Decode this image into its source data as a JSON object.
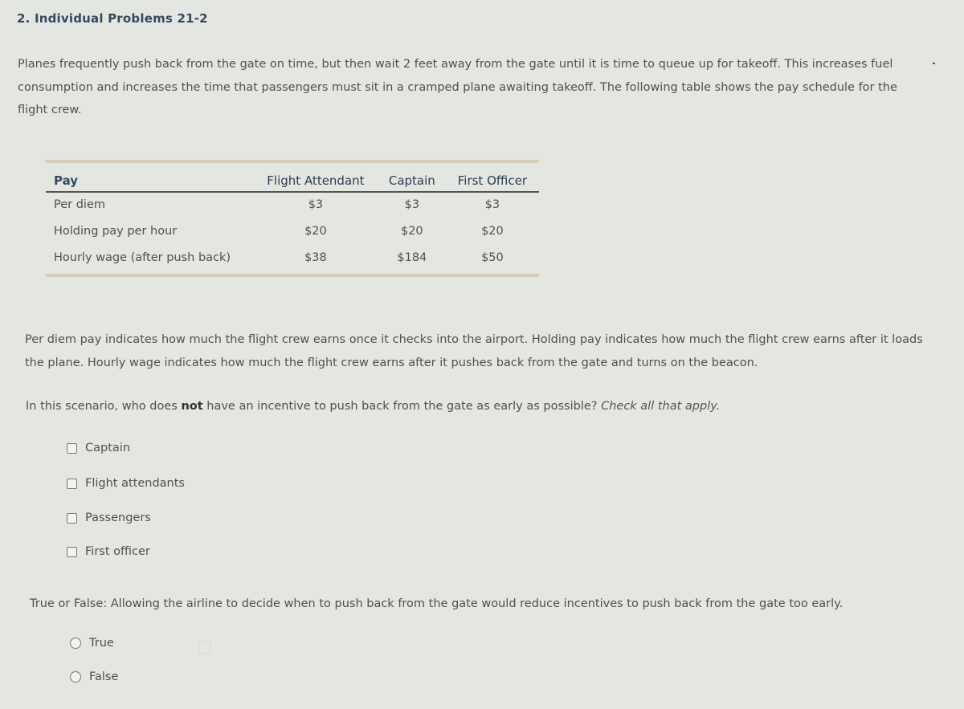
{
  "title": "2. Individual Problems 21-2",
  "intro": "Planes frequently push back from the gate on time, but then wait 2 feet away from the gate until it is time to queue up for takeoff. This increases fuel consumption and increases the time that passengers must sit in a cramped plane awaiting takeoff. The following table shows the pay schedule for the flight crew.",
  "table": {
    "headers": [
      "Pay",
      "Flight Attendant",
      "Captain",
      "First Officer"
    ],
    "rows": [
      [
        "Per diem",
        "$3",
        "$3",
        "$3"
      ],
      [
        "Holding pay per hour",
        "$20",
        "$20",
        "$20"
      ],
      [
        "Hourly wage (after push back)",
        "$38",
        "$184",
        "$50"
      ]
    ]
  },
  "explanation": "Per diem pay indicates how much the flight crew earns once it checks into the airport. Holding pay indicates how much the flight crew earns after it loads the plane. Hourly wage indicates how much the flight crew earns after it pushes back from the gate and turns on the beacon.",
  "question1": {
    "prefix": "In this scenario, who does ",
    "bold": "not",
    "middle": " have an incentive to push back from the gate as early as possible? ",
    "instruction": "Check all that apply.",
    "options": [
      {
        "label": "Captain",
        "checked": false
      },
      {
        "label": "Flight attendants",
        "checked": false
      },
      {
        "label": "Passengers",
        "checked": false
      },
      {
        "label": "First officer",
        "checked": false
      }
    ]
  },
  "question2": {
    "text": "True or False: Allowing the airline to decide when to push back from the gate would reduce incentives to push back from the gate too early.",
    "options": [
      {
        "label": "True",
        "selected": false
      },
      {
        "label": "False",
        "selected": false
      }
    ]
  }
}
